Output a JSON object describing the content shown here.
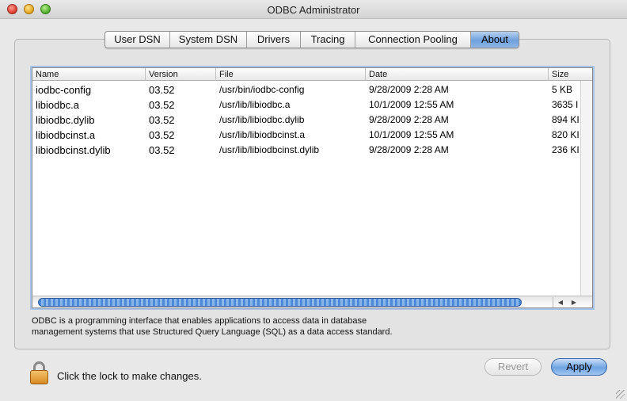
{
  "window": {
    "title": "ODBC Administrator"
  },
  "tabs": [
    {
      "label": "User DSN",
      "active": false
    },
    {
      "label": "System DSN",
      "active": false
    },
    {
      "label": "Drivers",
      "active": false
    },
    {
      "label": "Tracing",
      "active": false
    },
    {
      "label": "Connection Pooling",
      "active": false
    },
    {
      "label": "About",
      "active": true
    }
  ],
  "table": {
    "columns": [
      "Name",
      "Version",
      "File",
      "Date",
      "Size"
    ],
    "rows": [
      {
        "name": "iodbc-config",
        "version": "03.52",
        "file": "/usr/bin/iodbc-config",
        "date": "9/28/2009 2:28 AM",
        "size": "5 KB"
      },
      {
        "name": "libiodbc.a",
        "version": "03.52",
        "file": "/usr/lib/libiodbc.a",
        "date": "10/1/2009 12:55 AM",
        "size": "3635 I"
      },
      {
        "name": "libiodbc.dylib",
        "version": "03.52",
        "file": "/usr/lib/libiodbc.dylib",
        "date": "9/28/2009 2:28 AM",
        "size": "894 KI"
      },
      {
        "name": "libiodbcinst.a",
        "version": "03.52",
        "file": "/usr/lib/libiodbcinst.a",
        "date": "10/1/2009 12:55 AM",
        "size": "820 KI"
      },
      {
        "name": "libiodbcinst.dylib",
        "version": "03.52",
        "file": "/usr/lib/libiodbcinst.dylib",
        "date": "9/28/2009 2:28 AM",
        "size": "236 KI"
      }
    ]
  },
  "description": {
    "line1": "ODBC is a programming interface that enables applications to access data in database",
    "line2": "management systems that use Structured Query Language (SQL) as a data access standard."
  },
  "lock": {
    "message": "Click the lock to make changes.",
    "icon": "lock-icon"
  },
  "buttons": {
    "revert": "Revert",
    "apply": "Apply"
  },
  "colors": {
    "accent": "#6fa0dc",
    "scroll_thumb": "#4f8ad6"
  }
}
